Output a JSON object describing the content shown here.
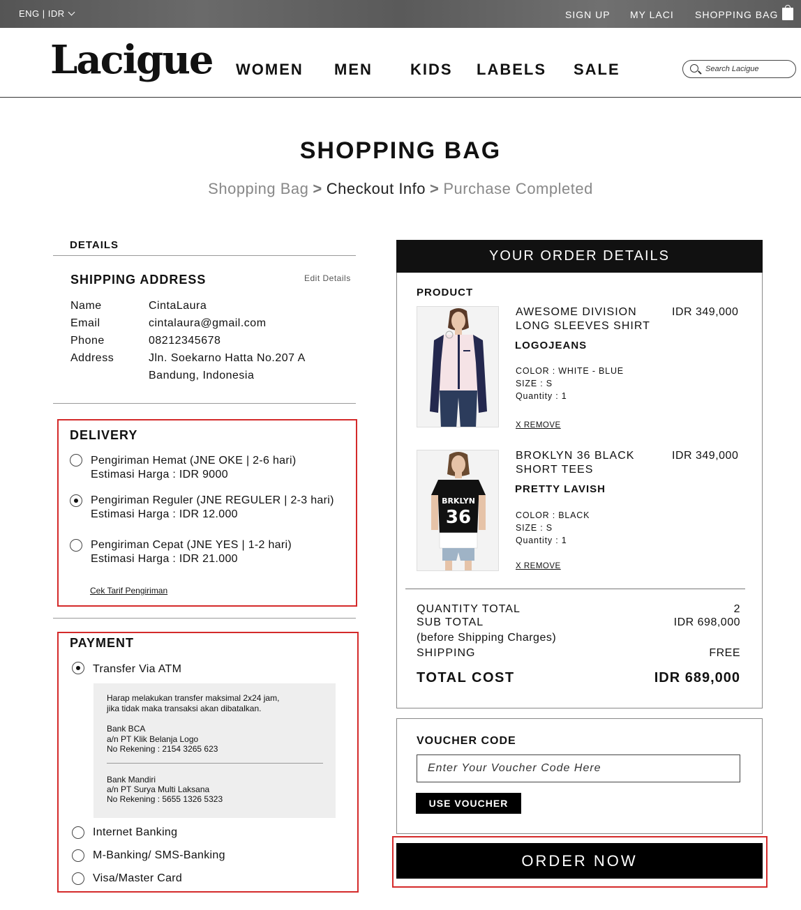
{
  "topbar": {
    "lang": "ENG | IDR",
    "signup": "SIGN UP",
    "mylaci": "MY LACI",
    "shopping_bag": "SHOPPING BAG"
  },
  "header": {
    "logo": "Lacigue",
    "nav": [
      "WOMEN",
      "MEN",
      "KIDS",
      "LABELS",
      "SALE"
    ],
    "search_placeholder": "Search Lacigue"
  },
  "page": {
    "title": "SHOPPING BAG",
    "breadcrumb": [
      "Shopping Bag",
      "Checkout Info",
      "Purchase Completed"
    ],
    "breadcrumb_sep": ">"
  },
  "details": {
    "label": "DETAILS",
    "shipping_title": "SHIPPING ADDRESS",
    "edit": "Edit Details",
    "fields": [
      {
        "label": "Name",
        "value": "CintaLaura"
      },
      {
        "label": "Email",
        "value": "cintalaura@gmail.com"
      },
      {
        "label": "Phone",
        "value": "08212345678"
      },
      {
        "label": "Address",
        "value": "Jln. Soekarno Hatta No.207 A",
        "value2": "Bandung, Indonesia"
      }
    ]
  },
  "delivery": {
    "title": "DELIVERY",
    "options": [
      {
        "line1": "Pengiriman Hemat (JNE OKE | 2-6 hari)",
        "line2": "Estimasi Harga : IDR 9000",
        "selected": false
      },
      {
        "line1": "Pengiriman Reguler (JNE REGULER | 2-3 hari)",
        "line2": "Estimasi Harga : IDR 12.000",
        "selected": true
      },
      {
        "line1": "Pengiriman Cepat (JNE YES | 1-2 hari)",
        "line2": "Estimasi Harga : IDR 21.000",
        "selected": false
      }
    ],
    "link": "Cek Tarif Pengiriman"
  },
  "payment": {
    "title": "PAYMENT",
    "options": [
      "Transfer Via ATM",
      "Internet Banking",
      "M-Banking/ SMS-Banking",
      "Visa/Master Card"
    ],
    "selected_index": 0,
    "info": {
      "note1": "Harap melakukan transfer maksimal 2x24 jam,",
      "note2": "jika tidak maka transaksi akan dibatalkan.",
      "bank1": "Bank BCA",
      "bank1_an": "a/n PT Klik Belanja Logo",
      "bank1_no": "No Rekening : 2154 3265 623",
      "bank2": "Bank Mandiri",
      "bank2_an": "a/n PT Surya Multi Laksana",
      "bank2_no": "No Rekening : 5655 1326 5323"
    }
  },
  "order": {
    "title": "YOUR ORDER DETAILS",
    "product_label": "PRODUCT",
    "items": [
      {
        "name1": "AWESOME DIVISION",
        "name2": "LONG SLEEVES SHIRT",
        "price": "IDR 349,000",
        "brand": "LOGOJEANS",
        "color": "COLOR : WHITE - BLUE",
        "size": "SIZE : S",
        "qty": "Quantity : 1",
        "remove": "X REMOVE"
      },
      {
        "name1": "BROKLYN 36 BLACK",
        "name2": "SHORT TEES",
        "price": "IDR 349,000",
        "brand": "PRETTY LAVISH",
        "color": "COLOR : BLACK",
        "size": "SIZE : S",
        "qty": "Quantity : 1",
        "remove": "X REMOVE",
        "shirt_text1": "BRKLYN",
        "shirt_text2": "36"
      }
    ],
    "qty_total_label": "QUANTITY TOTAL",
    "qty_total": "2",
    "subtotal_label": "SUB TOTAL",
    "subtotal": "IDR 698,000",
    "subtotal_note": "(before Shipping Charges)",
    "shipping_label": "SHIPPING",
    "shipping": "FREE",
    "total_label": "TOTAL COST",
    "total": "IDR 689,000"
  },
  "voucher": {
    "label": "VOUCHER CODE",
    "placeholder": "Enter Your Voucher Code Here",
    "button": "USE VOUCHER"
  },
  "order_now": "ORDER NOW",
  "colors": {
    "highlight": "#d42a2a",
    "accent": "#000000"
  }
}
